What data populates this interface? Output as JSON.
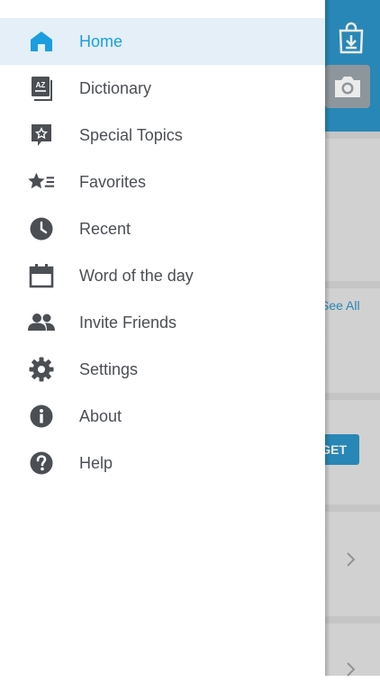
{
  "background": {
    "see_all_label": "See All",
    "get_label": "GET",
    "icons": [
      "shopping-bag-icon",
      "camera-icon",
      "chevron-right-icon"
    ]
  },
  "drawer": {
    "active_color": "#1a9ee0",
    "active_bg": "#e4eff7",
    "text_color": "#4b4f54",
    "items": [
      {
        "label": "Home",
        "icon": "home-icon",
        "active": true
      },
      {
        "label": "Dictionary",
        "icon": "dictionary-icon",
        "active": false
      },
      {
        "label": "Special Topics",
        "icon": "special-topics-icon",
        "active": false
      },
      {
        "label": "Favorites",
        "icon": "favorites-icon",
        "active": false
      },
      {
        "label": "Recent",
        "icon": "clock-icon",
        "active": false
      },
      {
        "label": "Word of the day",
        "icon": "calendar-icon",
        "active": false
      },
      {
        "label": "Invite Friends",
        "icon": "people-icon",
        "active": false
      },
      {
        "label": "Settings",
        "icon": "gear-icon",
        "active": false
      },
      {
        "label": "About",
        "icon": "info-icon",
        "active": false
      },
      {
        "label": "Help",
        "icon": "help-icon",
        "active": false
      }
    ]
  }
}
